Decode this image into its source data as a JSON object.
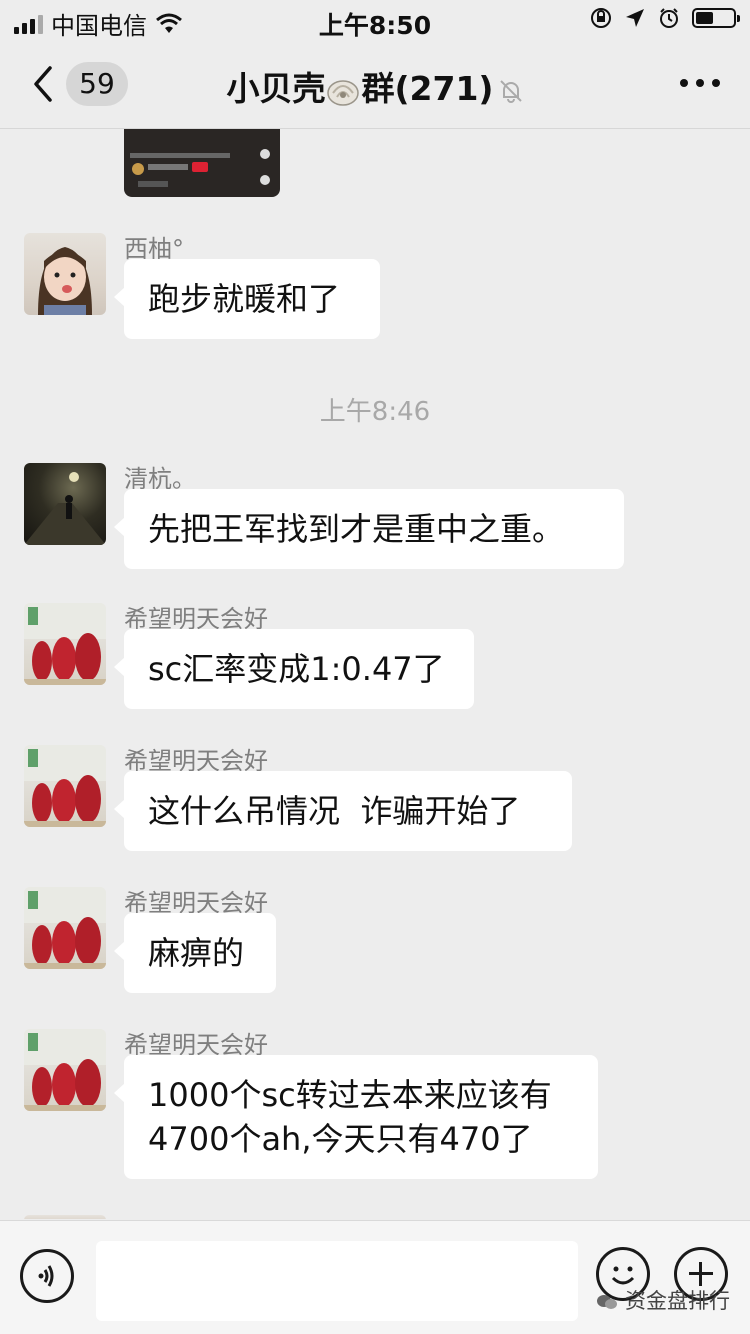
{
  "status_bar": {
    "carrier": "中国电信",
    "time": "上午8:50"
  },
  "nav": {
    "back_count": "59",
    "title": "小贝壳",
    "title_suffix": "群(271)"
  },
  "messages": [
    {
      "sender": "西柚°",
      "text": "跑步就暖和了"
    },
    {
      "sender": "清杭。",
      "text": "先把王军找到才是重中之重。"
    },
    {
      "sender": "希望明天会好",
      "text": "sc汇率变成1:0.47了"
    },
    {
      "sender": "希望明天会好",
      "text": "这什么吊情况  诈骗开始了"
    },
    {
      "sender": "希望明天会好",
      "text": "麻痹的"
    },
    {
      "sender": "希望明天会好",
      "text_line1": "1000个sc转过去本来应该有",
      "text_line2": "4700个ah,今天只有470了"
    }
  ],
  "timestamp": "上午8:46",
  "watermark": "资金盘排行",
  "icons": {
    "back": "chevron-left-icon",
    "mute": "bell-off-icon",
    "more": "more-icon",
    "voice": "voice-icon",
    "emoji": "emoji-icon",
    "plus": "plus-icon"
  }
}
